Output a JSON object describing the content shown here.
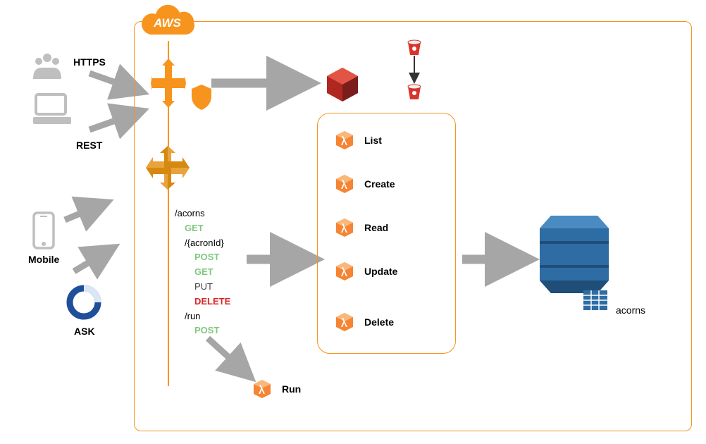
{
  "aws_label": "AWS",
  "clients": {
    "https": "HTTPS",
    "rest": "REST",
    "mobile": "Mobile",
    "ask": "ASK"
  },
  "api": {
    "root": "/acorns",
    "root_method": "GET",
    "item": "/{acronId}",
    "methods": {
      "post": "POST",
      "get": "GET",
      "put": "PUT",
      "delete": "DELETE"
    },
    "run": "/run",
    "run_method": "POST"
  },
  "lambdas": {
    "list": "List",
    "create": "Create",
    "read": "Read",
    "update": "Update",
    "delete": "Delete",
    "run": "Run"
  },
  "db": {
    "table": "acorns"
  }
}
